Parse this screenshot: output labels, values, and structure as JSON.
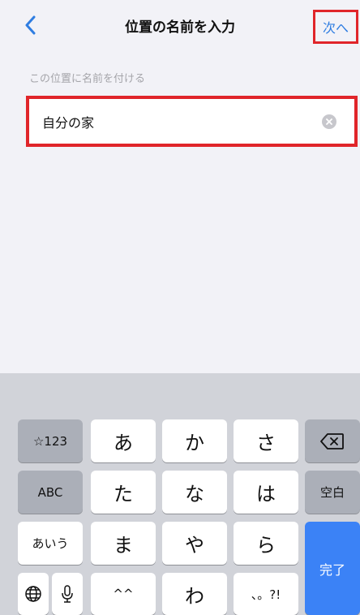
{
  "header": {
    "title": "位置の名前を入力",
    "next_label": "次へ"
  },
  "form": {
    "section_label": "この位置に名前を付ける",
    "name_value": "自分の家"
  },
  "keyboard": {
    "row1": {
      "mode": "☆123",
      "k1": "あ",
      "k2": "か",
      "k3": "さ"
    },
    "row2": {
      "mode": "ABC",
      "k1": "た",
      "k2": "な",
      "k3": "は",
      "space": "空白"
    },
    "row3": {
      "mode": "あいう",
      "k1": "ま",
      "k2": "や",
      "k3": "ら",
      "done": "完了"
    },
    "row4": {
      "k1": "^^",
      "k2": "わ",
      "k3": "、。?!"
    }
  },
  "colors": {
    "accent": "#2f7de1",
    "highlight": "#e0252a",
    "done_key": "#3b82f6"
  }
}
